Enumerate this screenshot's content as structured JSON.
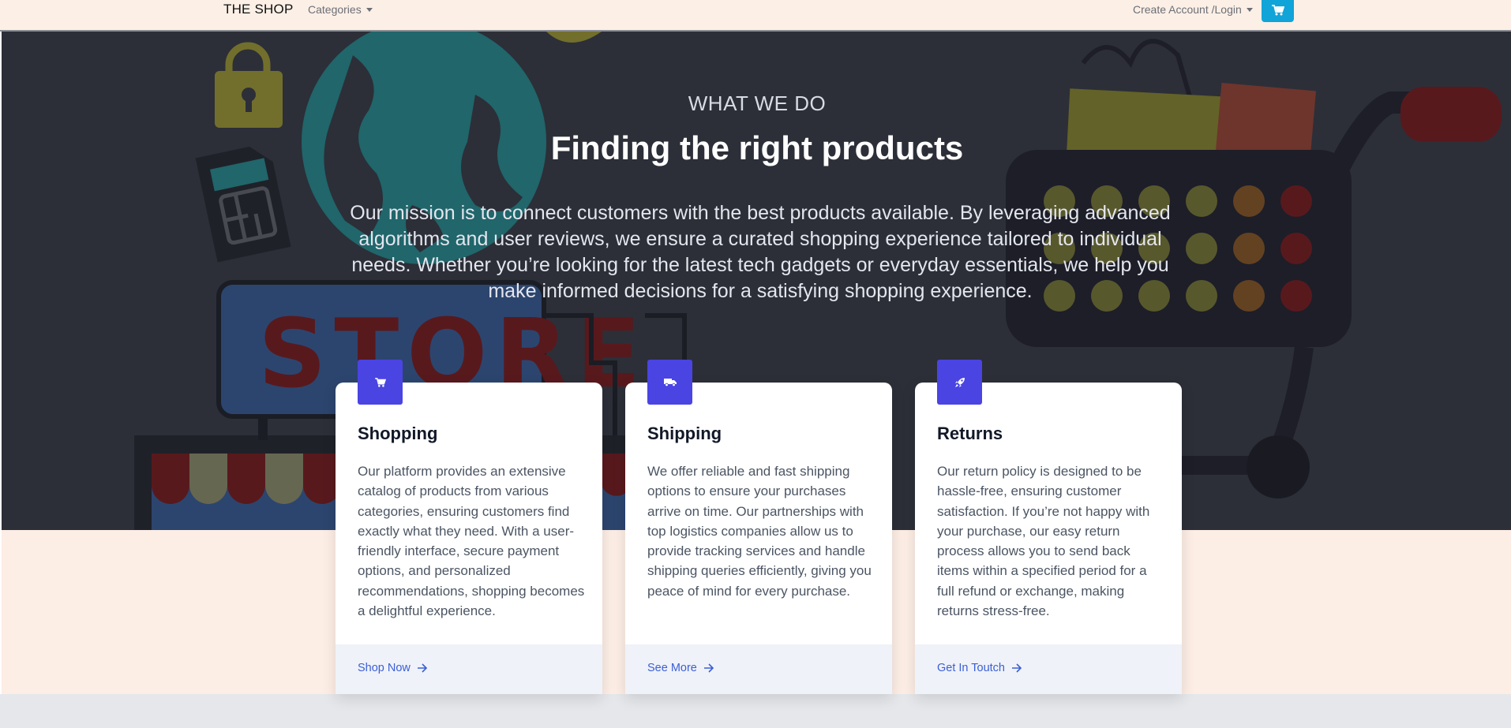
{
  "navbar": {
    "brand": "THE SHOP",
    "categories_label": "Categories",
    "account_label": "Create Account /Login",
    "cart_icon": "cart-icon"
  },
  "hero": {
    "eyebrow": "WHAT WE DO",
    "headline": "Finding the right products",
    "mission": "Our mission is to connect customers with the best products available. By leveraging advanced algorithms and user reviews, we ensure a curated shopping experience tailored to individual needs. Whether you’re looking for the latest tech gadgets or everyday essentials, we help you make informed decisions for a satisfying shopping experience.",
    "background_art_text": "STORE"
  },
  "cards": [
    {
      "icon": "cart-icon",
      "title": "Shopping",
      "text": "Our platform provides an extensive catalog of products from various categories, ensuring customers find exactly what they need. With a user-friendly interface, secure payment options, and personalized recommendations, shopping becomes a delightful experience.",
      "link": "Shop Now"
    },
    {
      "icon": "truck-icon",
      "title": "Shipping",
      "text": "We offer reliable and fast shipping options to ensure your purchases arrive on time. Our partnerships with top logistics companies allow us to provide tracking services and handle shipping queries efficiently, giving you peace of mind for every purchase.",
      "link": "See More"
    },
    {
      "icon": "rocket-icon",
      "title": "Returns",
      "text": "Our return policy is designed to be hassle-free, ensuring customer satisfaction. If you’re not happy with your purchase, our easy return process allows you to send back items within a specified period for a full refund or exchange, making returns stress-free.",
      "link": "Get In Toutch"
    }
  ],
  "colors": {
    "accent": "#4a44e3",
    "link": "#3b5fd6",
    "cart_button": "#10a4d8",
    "hero_bg": "#2f313b",
    "band_bg": "#fcede5"
  }
}
